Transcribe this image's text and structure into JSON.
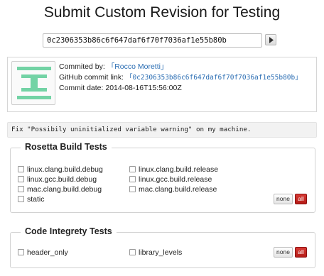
{
  "page": {
    "title": "Submit Custom Revision for Testing"
  },
  "revision": {
    "value": "0c2306353b86c6f647daf6f70f7036af1e55b80b"
  },
  "commit": {
    "author_label": "Commited by:",
    "author_name": "「Rocco Moretti」",
    "link_label": "GitHub commit link:",
    "link_text": "「0c2306353b86c6f647daf6f70f7036af1e55b80b」",
    "date_label": "Commit date:",
    "date": "2014-08-16T15:56:00Z"
  },
  "message": "Fix \"Possibily uninitialized variable warning\" on my machine.",
  "groups": [
    {
      "title": "Rosetta Build Tests",
      "tests": [
        "linux.clang.build.debug",
        "linux.clang.build.release",
        "linux.gcc.build.debug",
        "linux.gcc.build.release",
        "mac.clang.build.debug",
        "mac.clang.build.release",
        "static"
      ],
      "none_label": "none",
      "all_label": "all"
    },
    {
      "title": "Code Integrety Tests",
      "tests": [
        "header_only",
        "library_levels"
      ],
      "none_label": "none",
      "all_label": "all"
    }
  ],
  "icons": {
    "go": "play-arrow-icon",
    "avatar": "identicon-avatar"
  },
  "colors": {
    "link": "#2a6db3",
    "avatar_green": "#73d3a5",
    "all_button": "#c62a25"
  }
}
